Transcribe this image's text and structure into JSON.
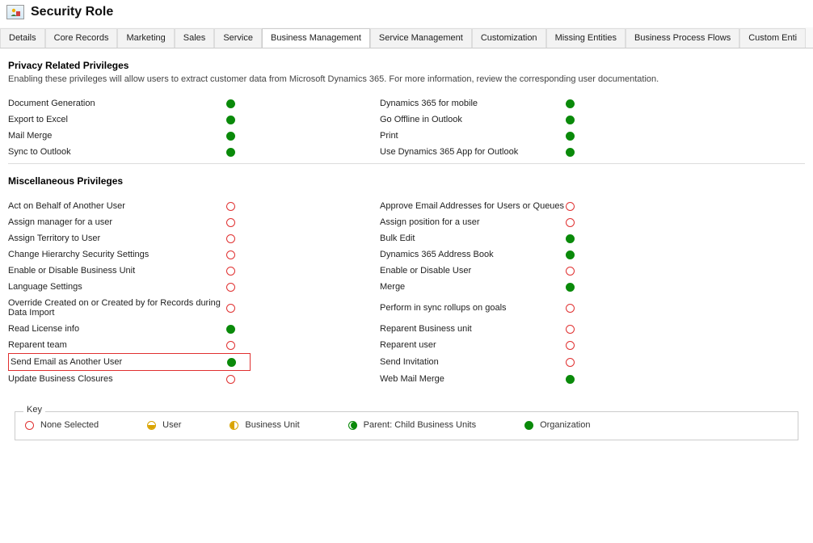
{
  "header": {
    "title": "Security Role"
  },
  "tabs": [
    {
      "label": "Details",
      "active": false
    },
    {
      "label": "Core Records",
      "active": false
    },
    {
      "label": "Marketing",
      "active": false
    },
    {
      "label": "Sales",
      "active": false
    },
    {
      "label": "Service",
      "active": false
    },
    {
      "label": "Business Management",
      "active": true
    },
    {
      "label": "Service Management",
      "active": false
    },
    {
      "label": "Customization",
      "active": false
    },
    {
      "label": "Missing Entities",
      "active": false
    },
    {
      "label": "Business Process Flows",
      "active": false
    },
    {
      "label": "Custom Enti",
      "active": false
    }
  ],
  "sections": {
    "privacy": {
      "title": "Privacy Related Privileges",
      "desc": "Enabling these privileges will allow users to extract customer data from Microsoft Dynamics 365. For more information, review the corresponding user documentation.",
      "rows": [
        {
          "left": "Document Generation",
          "leftLevel": "org",
          "right": "Dynamics 365 for mobile",
          "rightLevel": "org"
        },
        {
          "left": "Export to Excel",
          "leftLevel": "org",
          "right": "Go Offline in Outlook",
          "rightLevel": "org"
        },
        {
          "left": "Mail Merge",
          "leftLevel": "org",
          "right": "Print",
          "rightLevel": "org"
        },
        {
          "left": "Sync to Outlook",
          "leftLevel": "org",
          "right": "Use Dynamics 365 App for Outlook",
          "rightLevel": "org"
        }
      ]
    },
    "misc": {
      "title": "Miscellaneous Privileges",
      "rows": [
        {
          "left": "Act on Behalf of Another User",
          "leftLevel": "none",
          "right": "Approve Email Addresses for Users or Queues",
          "rightLevel": "none"
        },
        {
          "left": "Assign manager for a user",
          "leftLevel": "none",
          "right": "Assign position for a user",
          "rightLevel": "none"
        },
        {
          "left": "Assign Territory to User",
          "leftLevel": "none",
          "right": "Bulk Edit",
          "rightLevel": "org"
        },
        {
          "left": "Change Hierarchy Security Settings",
          "leftLevel": "none",
          "right": "Dynamics 365 Address Book",
          "rightLevel": "org"
        },
        {
          "left": "Enable or Disable Business Unit",
          "leftLevel": "none",
          "right": "Enable or Disable User",
          "rightLevel": "none"
        },
        {
          "left": "Language Settings",
          "leftLevel": "none",
          "right": "Merge",
          "rightLevel": "org"
        },
        {
          "left": "Override Created on or Created by for Records during Data Import",
          "leftLevel": "none",
          "right": "Perform in sync rollups on goals",
          "rightLevel": "none"
        },
        {
          "left": "Read License info",
          "leftLevel": "org",
          "right": "Reparent Business unit",
          "rightLevel": "none"
        },
        {
          "left": "Reparent team",
          "leftLevel": "none",
          "right": "Reparent user",
          "rightLevel": "none"
        },
        {
          "left": "Send Email as Another User",
          "leftLevel": "org",
          "right": "Send Invitation",
          "rightLevel": "none",
          "highlight": true
        },
        {
          "left": "Update Business Closures",
          "leftLevel": "none",
          "right": "Web Mail Merge",
          "rightLevel": "org"
        }
      ]
    }
  },
  "key": {
    "legend": "Key",
    "items": [
      {
        "level": "none",
        "label": "None Selected"
      },
      {
        "level": "user",
        "label": "User"
      },
      {
        "level": "bu",
        "label": "Business Unit"
      },
      {
        "level": "parent",
        "label": "Parent: Child Business Units"
      },
      {
        "level": "org",
        "label": "Organization"
      }
    ]
  }
}
